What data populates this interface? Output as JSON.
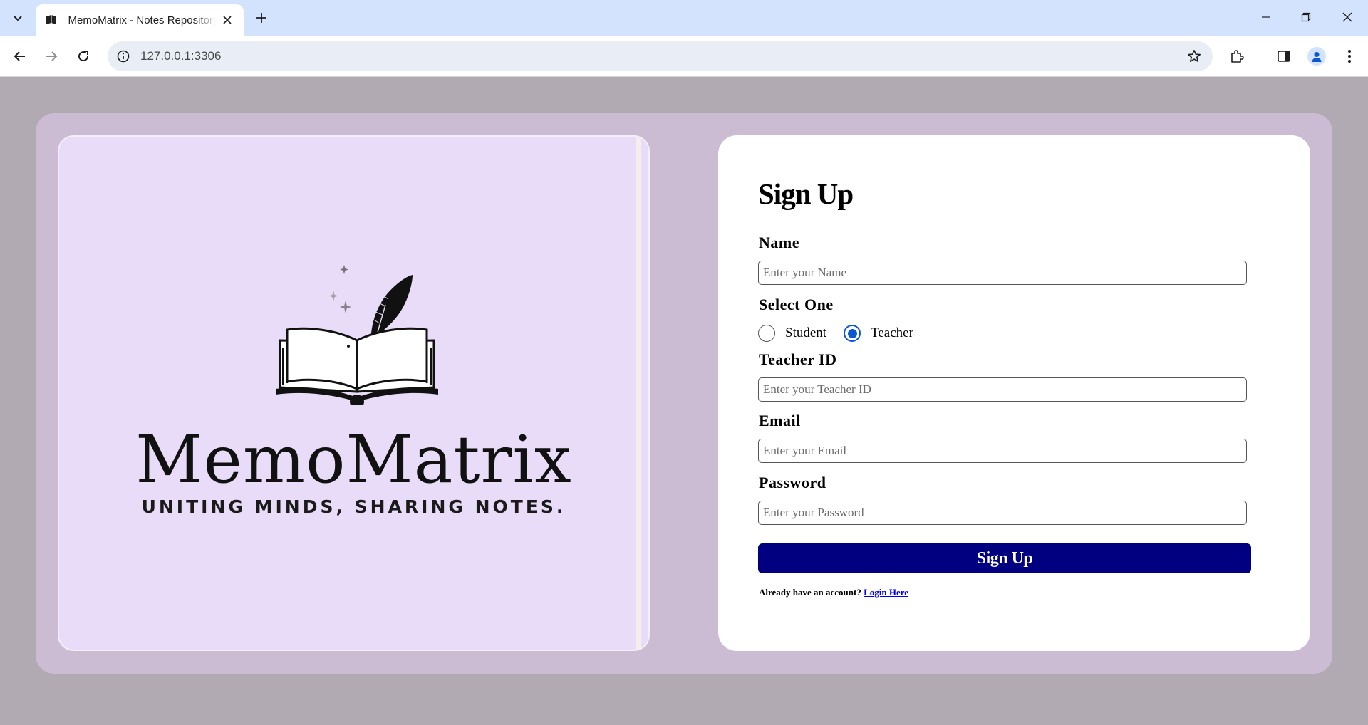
{
  "browser": {
    "tab_title": "MemoMatrix - Notes Repository",
    "url": "127.0.0.1:3306"
  },
  "brand": {
    "name": "MemoMatrix",
    "tagline": "UNITING MINDS, SHARING NOTES."
  },
  "form": {
    "title": "Sign Up",
    "name_label": "Name",
    "name_placeholder": "Enter your Name",
    "select_label": "Select One",
    "role_options": [
      "Student",
      "Teacher"
    ],
    "selected_role": "Teacher",
    "teacher_id_label": "Teacher ID",
    "teacher_id_placeholder": "Enter your Teacher ID",
    "email_label": "Email",
    "email_placeholder": "Enter your Email",
    "password_label": "Password",
    "password_placeholder": "Enter your Password",
    "submit_label": "Sign Up",
    "footer_text": "Already have an account?",
    "login_link": "Login Here"
  },
  "colors": {
    "page_bg": "#b2aab3",
    "card_bg": "#cbbbd3",
    "logo_bg": "#e9dcf8",
    "button_bg": "#000080",
    "radio_accent": "#0b57d0"
  }
}
